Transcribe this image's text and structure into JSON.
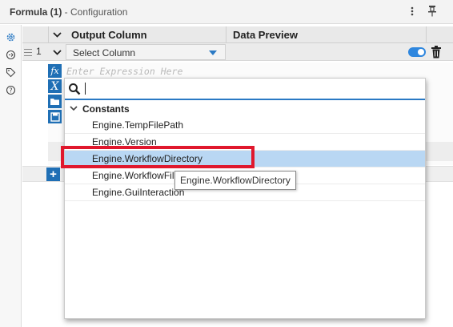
{
  "panel": {
    "title": "Formula (1)",
    "subtitle": " - Configuration",
    "menu_icon": "more-vertical-icon",
    "pin_icon": "pin-icon"
  },
  "left_strip": {
    "icons": [
      "gear-icon",
      "connection-icon",
      "tag-icon",
      "help-icon"
    ]
  },
  "grid": {
    "columns": [
      "Output Column",
      "Data Preview"
    ],
    "rows": [
      {
        "number": "1",
        "output_column": "Select Column",
        "enabled": true
      }
    ]
  },
  "editor": {
    "placeholder": "Enter Expression Here",
    "tools": [
      "function-icon",
      "variable-icon",
      "folder-icon",
      "save-icon"
    ]
  },
  "popup": {
    "search_value": "",
    "group_label": "Constants",
    "items": [
      "Engine.TempFilePath",
      "Engine.Version",
      "Engine.WorkflowDirectory",
      "Engine.WorkflowFileName",
      "Engine.GuiInteraction"
    ],
    "selected_index": 2
  },
  "tooltip": "Engine.WorkflowDirectory",
  "colors": {
    "accent": "#2a79c4",
    "button_blue": "#1f6fb5",
    "selection": "#b9d7f3",
    "highlight_red": "#e0182d"
  }
}
